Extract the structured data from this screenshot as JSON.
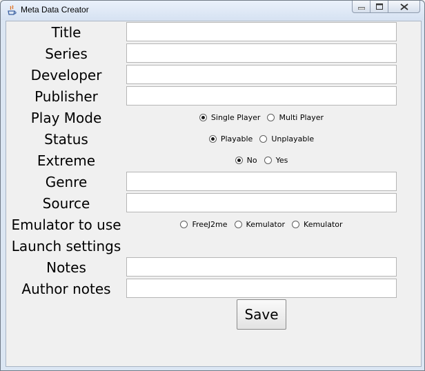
{
  "window": {
    "title": "Meta Data Creator"
  },
  "fields": [
    {
      "label": "Title",
      "type": "text",
      "value": ""
    },
    {
      "label": "Series",
      "type": "text",
      "value": ""
    },
    {
      "label": "Developer",
      "type": "text",
      "value": ""
    },
    {
      "label": "Publisher",
      "type": "text",
      "value": ""
    },
    {
      "label": "Play Mode",
      "type": "radio",
      "options": [
        {
          "label": "Single Player",
          "checked": true
        },
        {
          "label": "Multi Player",
          "checked": false
        }
      ]
    },
    {
      "label": "Status",
      "type": "radio",
      "options": [
        {
          "label": "Playable",
          "checked": true
        },
        {
          "label": "Unplayable",
          "checked": false
        }
      ]
    },
    {
      "label": "Extreme",
      "type": "radio",
      "options": [
        {
          "label": "No",
          "checked": true
        },
        {
          "label": "Yes",
          "checked": false
        }
      ]
    },
    {
      "label": "Genre",
      "type": "text",
      "value": ""
    },
    {
      "label": "Source",
      "type": "text",
      "value": ""
    },
    {
      "label": "Emulator to use",
      "type": "radio",
      "options": [
        {
          "label": "FreeJ2me",
          "checked": false
        },
        {
          "label": "Kemulator",
          "checked": false
        },
        {
          "label": "Kemulator",
          "checked": false
        }
      ]
    },
    {
      "label": "Launch settings",
      "type": "none"
    },
    {
      "label": "Notes",
      "type": "text",
      "value": ""
    },
    {
      "label": "Author notes",
      "type": "text",
      "value": ""
    }
  ],
  "save_label": "Save"
}
